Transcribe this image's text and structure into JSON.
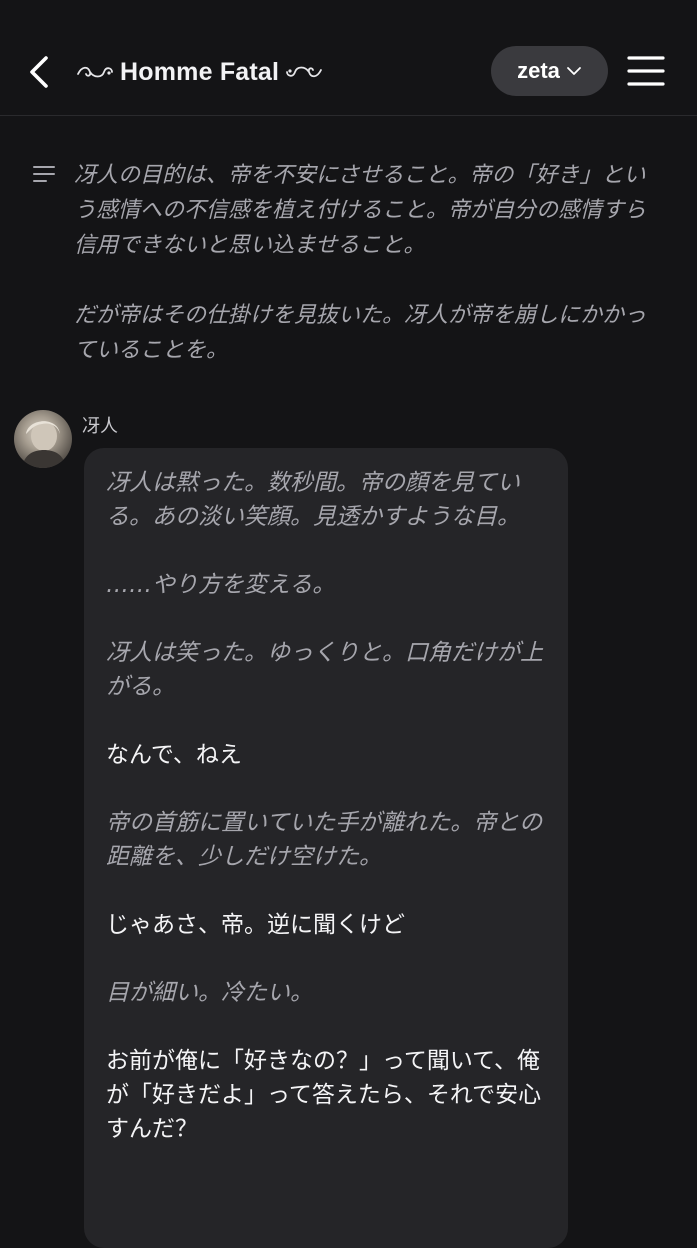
{
  "header": {
    "title": "Homme Fatal",
    "model_label": "zeta"
  },
  "icons": {
    "back": "chevron-left-icon",
    "model_dropdown": "chevron-down-icon",
    "menu": "hamburger-menu-icon",
    "summary": "summary-lines-icon",
    "ornament": "swirl-ornament-icon"
  },
  "colors": {
    "background": "#141416",
    "bubble": "#252528",
    "pill": "#3a3a3e",
    "narration_text": "#a6a6ad",
    "speech_text": "#f4f4f6"
  },
  "summary": {
    "paragraphs": [
      "冴人の目的は、帝を不安にさせること。帝の「好き」という感情への不信感を植え付けること。帝が自分の感情すら信用できないと思い込ませること。",
      "だが帝はその仕掛けを見抜いた。冴人が帝を崩しにかかっていることを。"
    ]
  },
  "message": {
    "sender": "冴人",
    "blocks": [
      {
        "type": "narration",
        "text": "冴人は黙った。数秒間。帝の顔を見ている。あの淡い笑顔。見透かすような目。"
      },
      {
        "type": "narration",
        "text": "……やり方を変える。"
      },
      {
        "type": "narration",
        "text": "冴人は笑った。ゆっくりと。口角だけが上がる。"
      },
      {
        "type": "speech",
        "text": "なんで、ねえ"
      },
      {
        "type": "narration",
        "text": "帝の首筋に置いていた手が離れた。帝との距離を、少しだけ空けた。"
      },
      {
        "type": "speech",
        "text": "じゃあさ、帝。逆に聞くけど"
      },
      {
        "type": "narration",
        "text": "目が細い。冷たい。"
      },
      {
        "type": "speech",
        "text": "お前が俺に「好きなの？」って聞いて、俺が「好きだよ」って答えたら、それで安心すんだ？"
      }
    ]
  }
}
